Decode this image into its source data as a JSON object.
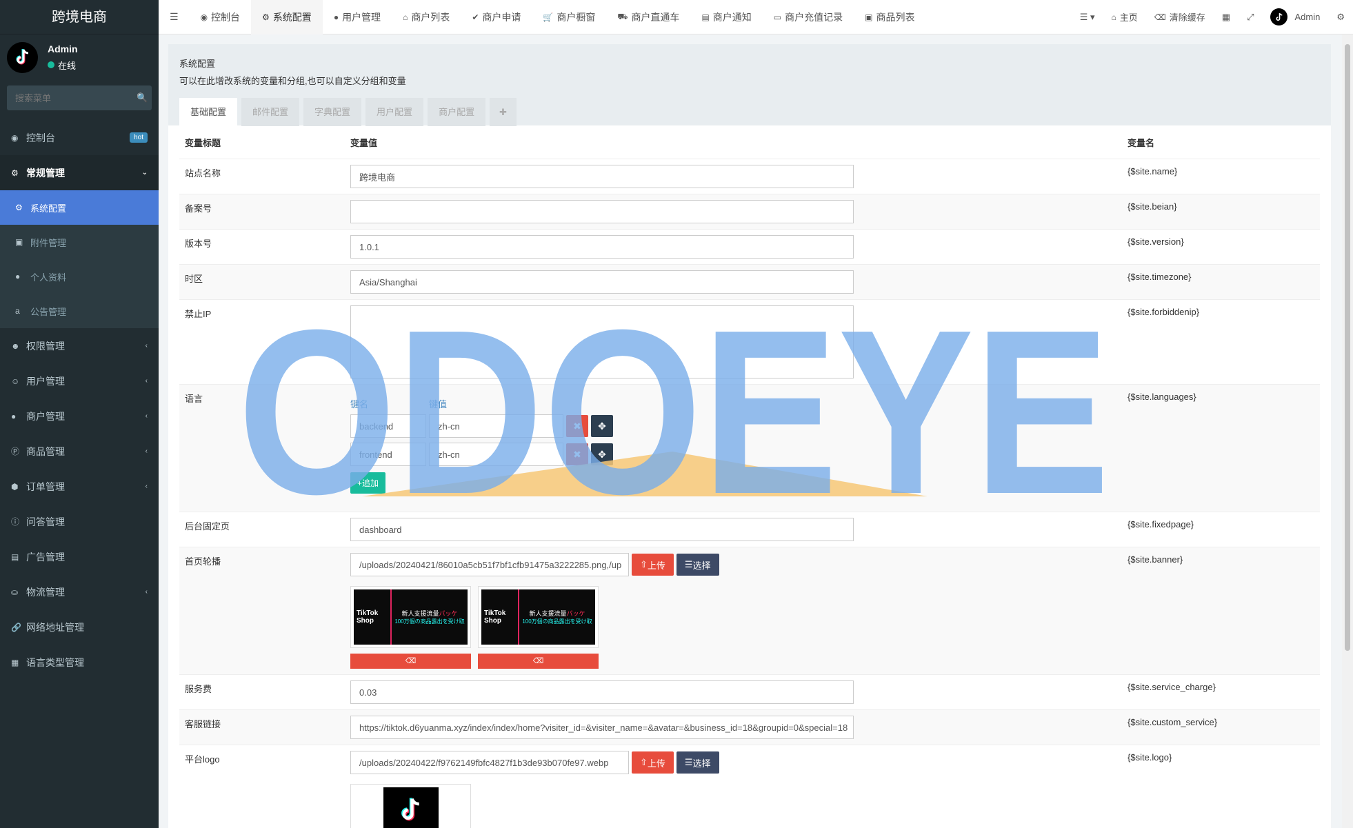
{
  "brand": "跨境电商",
  "user": {
    "name": "Admin",
    "status": "在线"
  },
  "side_search": {
    "placeholder": "搜索菜单"
  },
  "sidebar": {
    "items": [
      {
        "label": "控制台",
        "badge": "hot"
      },
      {
        "label": "常规管理"
      },
      {
        "label": "系统配置"
      },
      {
        "label": "附件管理"
      },
      {
        "label": "个人资料"
      },
      {
        "label": "公告管理"
      },
      {
        "label": "权限管理"
      },
      {
        "label": "用户管理"
      },
      {
        "label": "商户管理"
      },
      {
        "label": "商品管理"
      },
      {
        "label": "订单管理"
      },
      {
        "label": "问答管理"
      },
      {
        "label": "广告管理"
      },
      {
        "label": "物流管理"
      },
      {
        "label": "网络地址管理"
      },
      {
        "label": "语言类型管理"
      }
    ]
  },
  "topnav": {
    "tabs": [
      "控制台",
      "系统配置",
      "用户管理",
      "商户列表",
      "商户申请",
      "商户橱窗",
      "商户直通车",
      "商户通知",
      "商户充值记录",
      "商品列表"
    ],
    "home": "主页",
    "clear_cache": "清除缓存",
    "user": "Admin"
  },
  "panel": {
    "title": "系统配置",
    "desc": "可以在此增改系统的变量和分组,也可以自定义分组和变量",
    "tabs": [
      "基础配置",
      "邮件配置",
      "字典配置",
      "用户配置",
      "商户配置"
    ]
  },
  "table": {
    "headers": {
      "title": "变量标题",
      "value": "变量值",
      "name": "变量名"
    },
    "rows": {
      "site_name": {
        "label": "站点名称",
        "value": "跨境电商",
        "var": "{$site.name}"
      },
      "beian": {
        "label": "备案号",
        "value": "",
        "var": "{$site.beian}"
      },
      "version": {
        "label": "版本号",
        "value": "1.0.1",
        "var": "{$site.version}"
      },
      "timezone": {
        "label": "时区",
        "value": "Asia/Shanghai",
        "var": "{$site.timezone}"
      },
      "forbiddenip": {
        "label": "禁止IP",
        "value": "",
        "var": "{$site.forbiddenip}"
      },
      "languages": {
        "label": "语言",
        "var": "{$site.languages}",
        "key_head": "键名",
        "val_head": "键值",
        "pairs": [
          {
            "k": "backend",
            "v": "zh-cn"
          },
          {
            "k": "frontend",
            "v": "zh-cn"
          }
        ],
        "add_label": "追加"
      },
      "fixedpage": {
        "label": "后台固定页",
        "value": "dashboard",
        "var": "{$site.fixedpage}"
      },
      "banner": {
        "label": "首页轮播",
        "value": "/uploads/20240421/86010a5cb51f7bf1cfb91475a3222285.png,/up",
        "var": "{$site.banner}",
        "upload": "上传",
        "select": "选择",
        "thumb_left": [
          "TikTok",
          "Shop"
        ],
        "thumb_line1": "新人支援流量",
        "thumb_pink": "パッケ",
        "thumb_line2": "100万個の商品露出を受け取"
      },
      "service_charge": {
        "label": "服务费",
        "value": "0.03",
        "var": "{$site.service_charge}"
      },
      "custom_service": {
        "label": "客服链接",
        "value": "https://tiktok.d6yuanma.xyz/index/index/home?visiter_id=&visiter_name=&avatar=&business_id=18&groupid=0&special=18",
        "var": "{$site.custom_service}"
      },
      "logo": {
        "label": "平台logo",
        "value": "/uploads/20240422/f9762149fbfc4827f1b3de93b070fe97.webp",
        "var": "{$site.logo}",
        "upload": "上传",
        "select": "选择"
      }
    }
  },
  "watermark": {
    "text": "ODOEYE"
  },
  "colors": {
    "sidebar_bg": "#222d32",
    "active_menu": "#4a7bd8",
    "danger": "#e74c3c",
    "success": "#18bc9c",
    "watermark": "#7aaeea"
  }
}
